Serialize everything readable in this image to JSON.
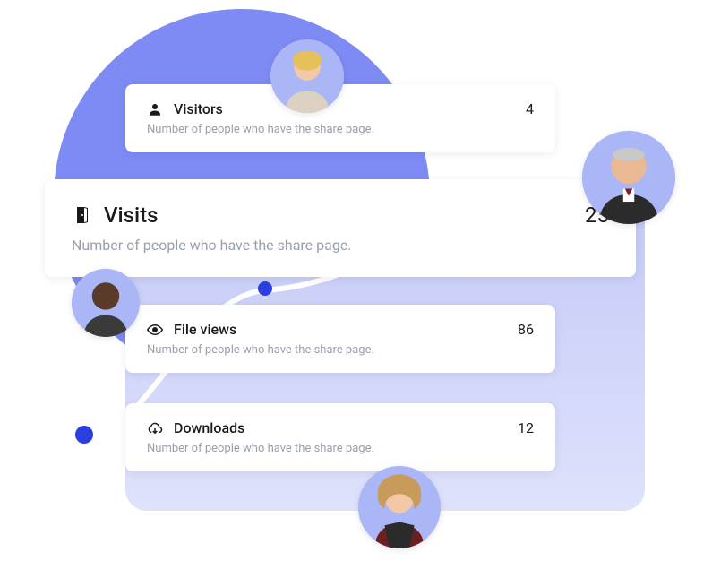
{
  "metrics": [
    {
      "icon": "user-icon",
      "title": "Visitors",
      "value": "4",
      "desc": "Number of people who have the share page."
    },
    {
      "icon": "door-icon",
      "title": "Visits",
      "value": "25",
      "desc": "Number of people who have the share page."
    },
    {
      "icon": "eye-icon",
      "title": "File views",
      "value": "86",
      "desc": "Number of people who have the share page."
    },
    {
      "icon": "cloud-icon",
      "title": "Downloads",
      "value": "12",
      "desc": "Number of people who have the share page."
    }
  ],
  "colors": {
    "accent": "#2b3fe0",
    "blob": "#7e8bf5",
    "panel": "#c3c9f7"
  }
}
